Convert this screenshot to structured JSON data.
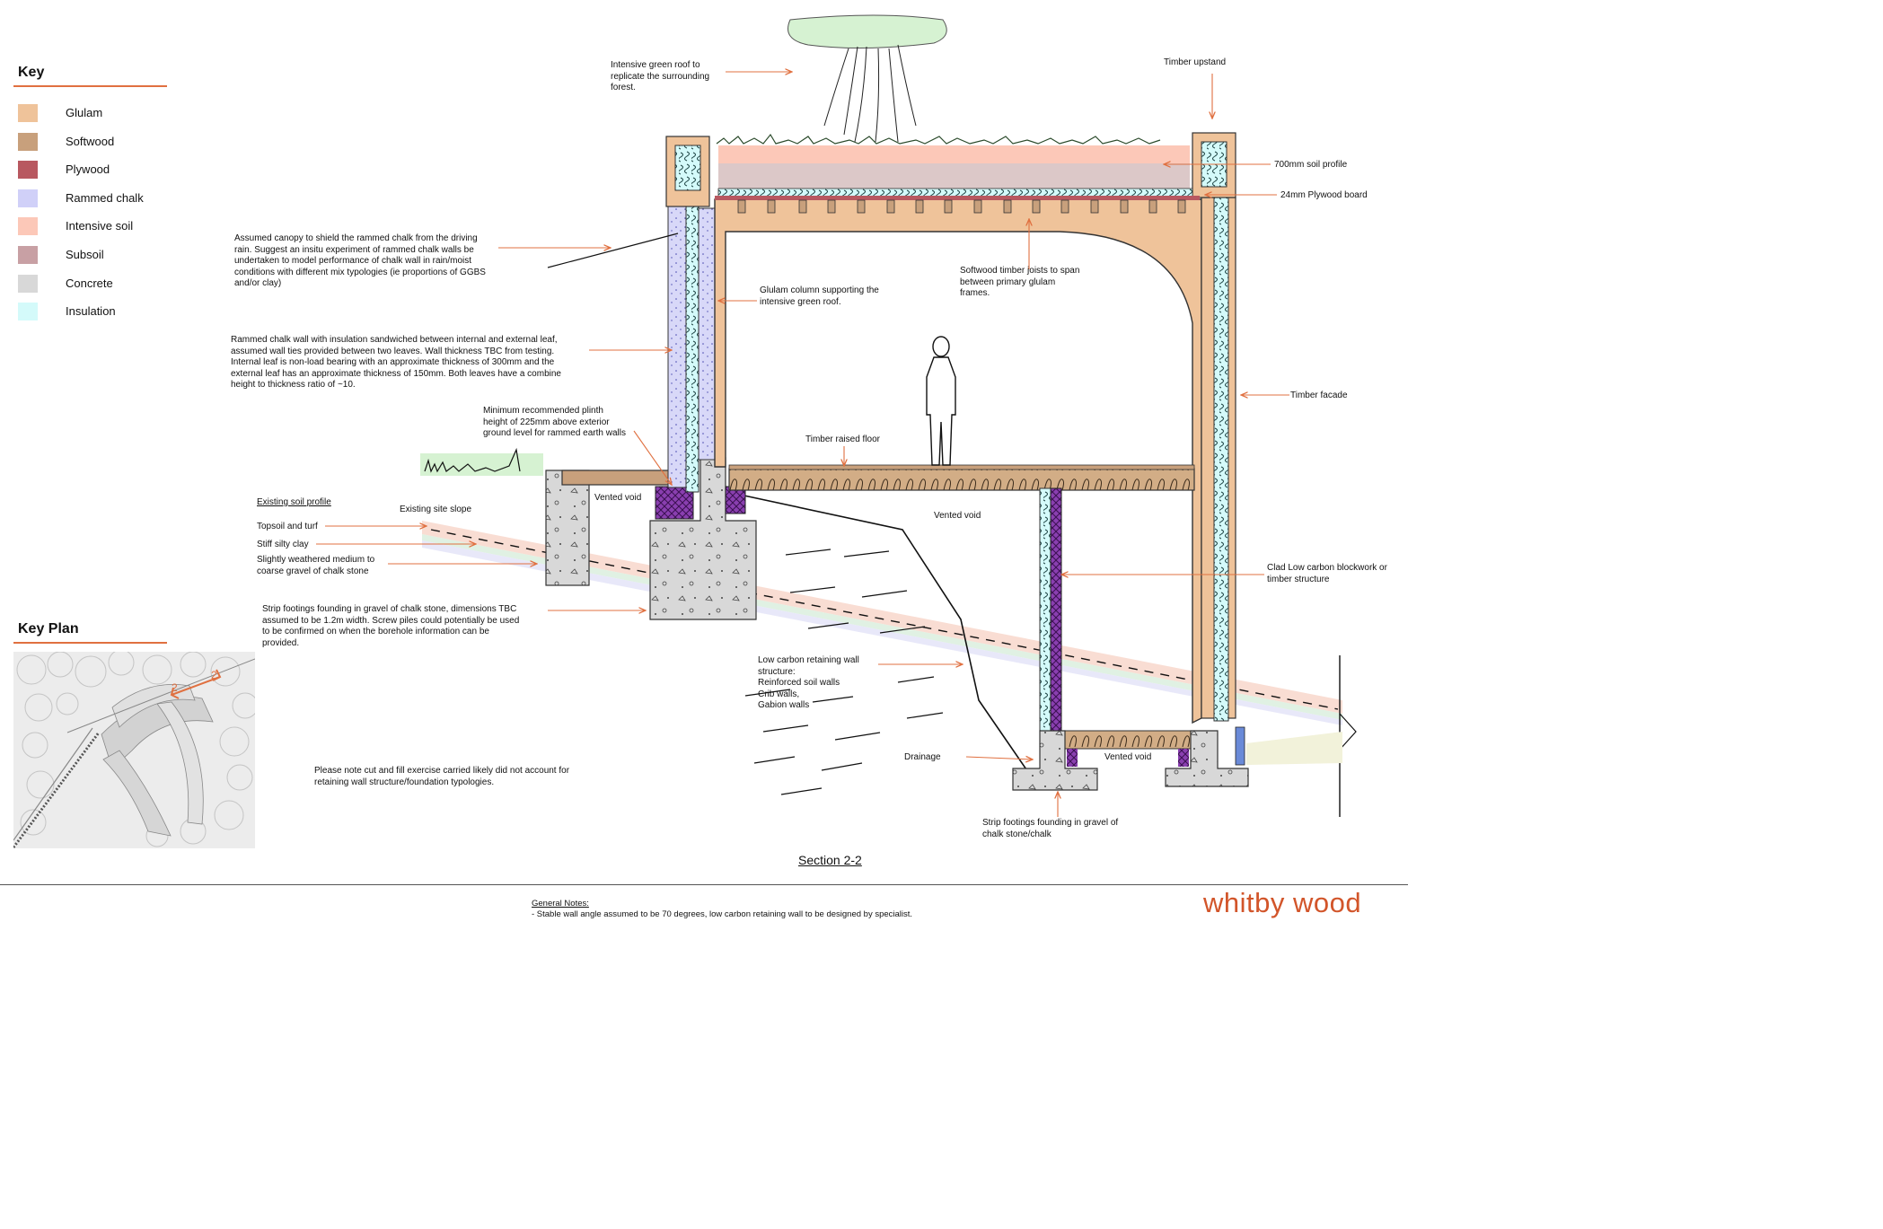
{
  "key": {
    "title": "Key",
    "items": [
      {
        "label": "Glulam",
        "color": "#efc39a"
      },
      {
        "label": "Softwood",
        "color": "#c8a07c"
      },
      {
        "label": "Plywood",
        "color": "#b85860"
      },
      {
        "label": "Rammed chalk",
        "color": "#d0d0f8"
      },
      {
        "label": "Intensive soil",
        "color": "#fcc8b8"
      },
      {
        "label": "Subsoil",
        "color": "#c8a0a4"
      },
      {
        "label": "Concrete",
        "color": "#d8d8d8"
      },
      {
        "label": "Insulation",
        "color": "#d4fafa"
      }
    ]
  },
  "key_plan": {
    "title": "Key Plan",
    "section_marks": [
      "2",
      "2"
    ]
  },
  "notes": {
    "canopy": [
      "Assumed canopy to shield the rammed chalk from the driving",
      "rain.  Suggest an insitu experiment of rammed chalk walls be",
      "undertaken to model performance of chalk wall in rain/moist",
      "conditions with different mix typologies (ie proportions of GGBS",
      "and/or clay)"
    ],
    "rammed_wall": [
      "Rammed chalk wall with insulation sandwiched between internal and external leaf,",
      "assumed wall ties provided between two leaves. Wall thickness TBC from testing.",
      "Internal leaf is non-load bearing with an approximate thickness of 300mm and the",
      "external leaf has an approximate thickness of 150mm.  Both leaves have a combine",
      "height to thickness ratio of ~10."
    ],
    "plinth": [
      "Minimum recommended plinth",
      "height of 225mm above exterior",
      "ground level for rammed earth walls"
    ],
    "green_roof": [
      "Intensive green roof to",
      "replicate the surrounding",
      "forest."
    ],
    "glulam_column": [
      "Glulam column supporting the",
      "intensive green roof."
    ],
    "joists": [
      "Softwood timber joists to span",
      "between primary glulam",
      "frames."
    ],
    "strip_footings": [
      "Strip footings founding in gravel of chalk stone, dimensions TBC",
      "assumed to be 1.2m width.  Screw piles could potentially be used",
      "to be confirmed on when the borehole information can be",
      "provided."
    ],
    "retaining": [
      "Low carbon retaining wall",
      "structure:",
      "Reinforced soil walls",
      "Crib walls,",
      "Gabion walls"
    ],
    "cut_fill": [
      "Please note cut and fill exercise carried likely did not account for",
      "retaining wall structure/foundation typologies."
    ],
    "strip_footings_2": [
      "Strip footings founding in gravel of",
      "chalk stone/chalk"
    ],
    "blockwork": [
      "Clad Low carbon blockwork or",
      "timber structure"
    ]
  },
  "labels": {
    "timber_upstand": "Timber upstand",
    "soil_profile_700": "700mm soil profile",
    "plywood_board": "24mm Plywood board",
    "timber_facade": "Timber facade",
    "timber_raised_floor": "Timber raised floor",
    "vented_void_1": "Vented void",
    "vented_void_2": "Vented void",
    "vented_void_3": "Vented void",
    "existing_site_slope": "Existing site slope",
    "existing_soil_profile": "Existing soil profile",
    "topsoil": "Topsoil and turf",
    "stiff_clay": "Stiff silty clay",
    "gravel_1": "Slightly weathered medium to",
    "gravel_2": "coarse gravel of chalk stone",
    "drainage": "Drainage"
  },
  "section_title": "Section 2-2",
  "general_notes": {
    "heading": "General Notes:",
    "line1": "- Stable wall angle assumed to be 70 degrees, low carbon retaining wall to be designed by specialist."
  },
  "brand": "whitby wood",
  "accent_color": "#e07040"
}
